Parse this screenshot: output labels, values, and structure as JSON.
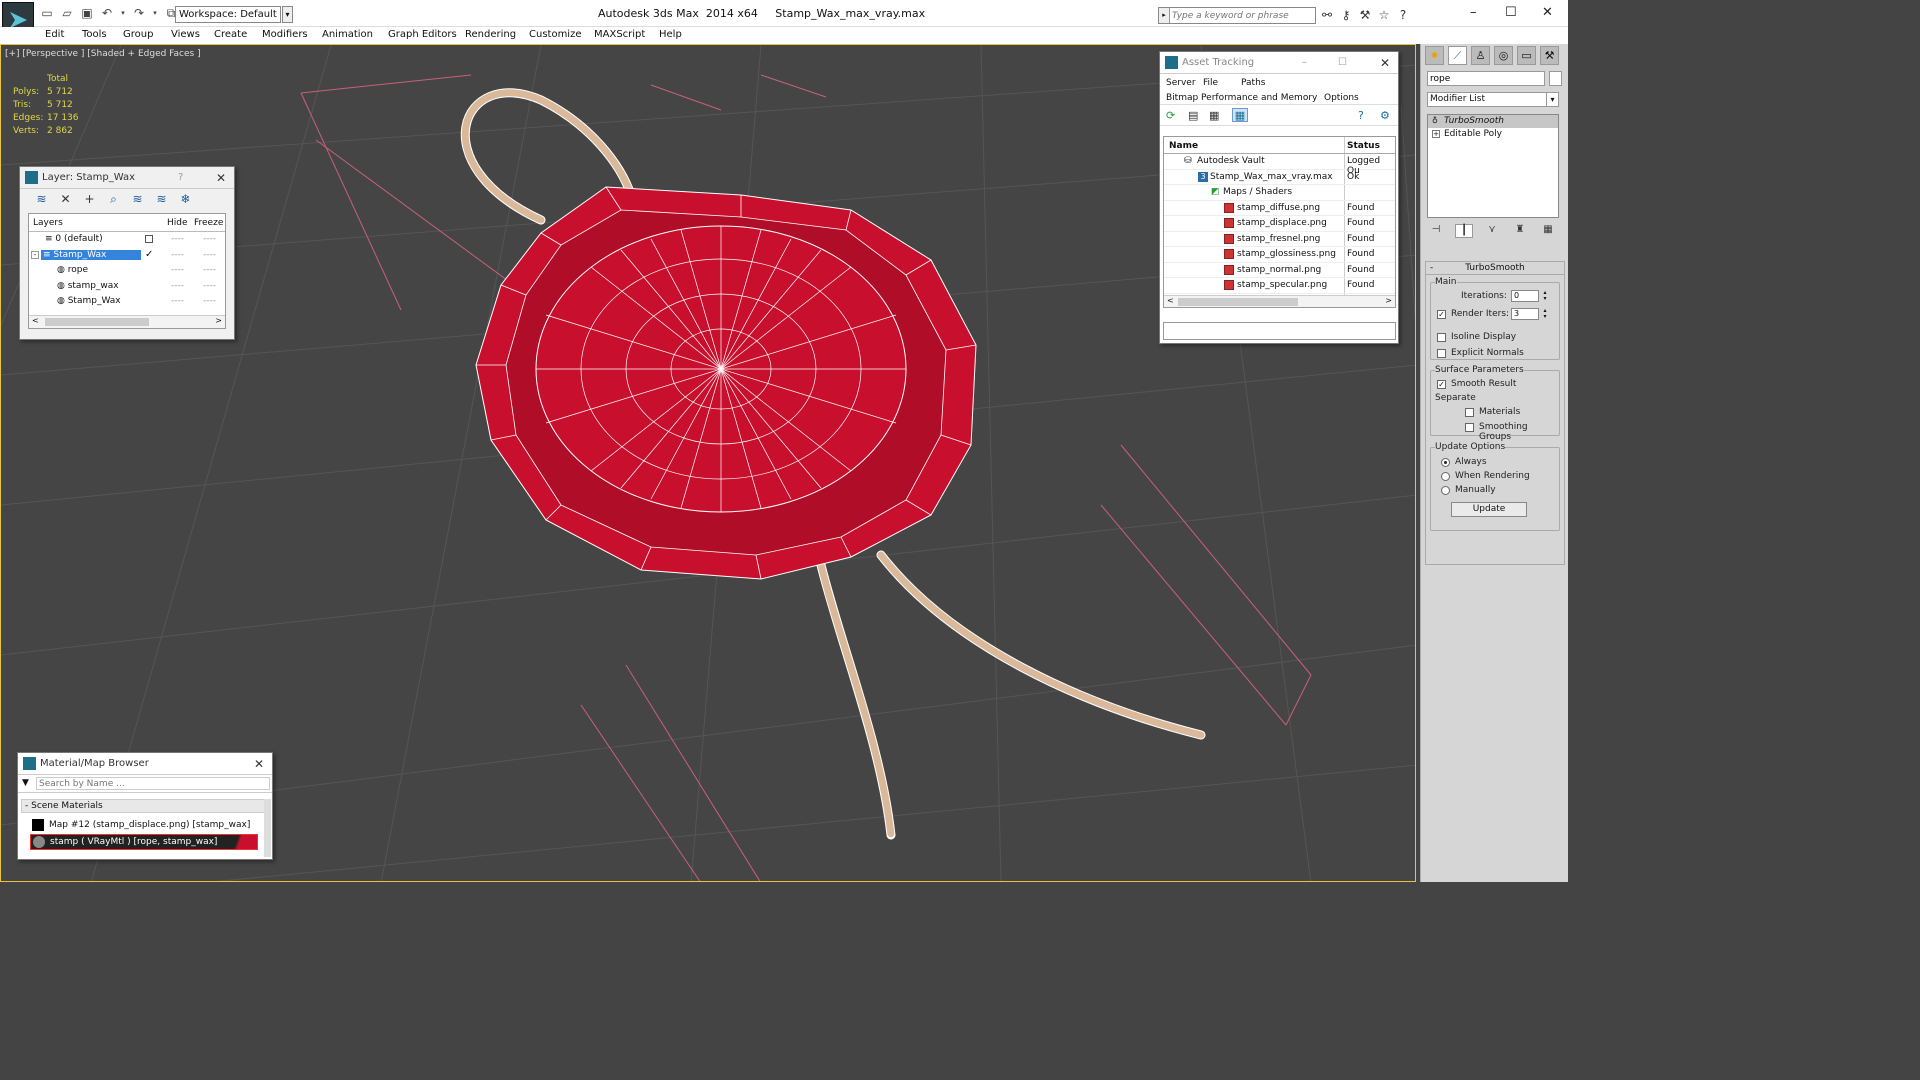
{
  "titlebar": {
    "workspace": "Workspace: Default",
    "title": "Autodesk 3ds Max  2014 x64     Stamp_Wax_max_vray.max",
    "search_placeholder": "Type a keyword or phrase"
  },
  "menu": [
    "Edit",
    "Tools",
    "Group",
    "Views",
    "Create",
    "Modifiers",
    "Animation",
    "Graph Editors",
    "Rendering",
    "Customize",
    "MAXScript",
    "Help"
  ],
  "viewport": {
    "label": "[+] [Perspective ] [Shaded + Edged Faces ]",
    "stats_header": "Total",
    "stats": [
      {
        "k": "Polys:",
        "v": "5 712"
      },
      {
        "k": "Tris:",
        "v": "5 712"
      },
      {
        "k": "Edges:",
        "v": "17 136"
      },
      {
        "k": "Verts:",
        "v": "2 862"
      }
    ],
    "colors": {
      "wax": "#c8102e",
      "rope": "#d9b99a",
      "grid": "#5a5a5a",
      "background": "#454545"
    }
  },
  "layer_panel": {
    "title": "Layer: Stamp_Wax",
    "help": "?",
    "columns": {
      "layers": "Layers",
      "hide": "Hide",
      "freeze": "Freeze"
    },
    "rows": [
      {
        "name": "0 (default)",
        "indent": 0,
        "selected": false
      },
      {
        "name": "Stamp_Wax",
        "indent": 0,
        "selected": true
      },
      {
        "name": "rope",
        "indent": 1,
        "selected": false
      },
      {
        "name": "stamp_wax",
        "indent": 1,
        "selected": false
      },
      {
        "name": "Stamp_Wax",
        "indent": 1,
        "selected": false
      }
    ],
    "dash": "----"
  },
  "asset_panel": {
    "title": "Asset Tracking",
    "menu": [
      "Server",
      "File",
      "Paths",
      "Bitmap Performance and Memory",
      "Options"
    ],
    "columns": {
      "name": "Name",
      "status": "Status"
    },
    "rows": [
      {
        "name": "Autodesk Vault",
        "status": "Logged Ou",
        "level": 1
      },
      {
        "name": "Stamp_Wax_max_vray.max",
        "status": "Ok",
        "level": 2
      },
      {
        "name": "Maps / Shaders",
        "status": "",
        "level": 3
      },
      {
        "name": "stamp_diffuse.png",
        "status": "Found",
        "level": 4
      },
      {
        "name": "stamp_displace.png",
        "status": "Found",
        "level": 4
      },
      {
        "name": "stamp_fresnel.png",
        "status": "Found",
        "level": 4
      },
      {
        "name": "stamp_glossiness.png",
        "status": "Found",
        "level": 4
      },
      {
        "name": "stamp_normal.png",
        "status": "Found",
        "level": 4
      },
      {
        "name": "stamp_specular.png",
        "status": "Found",
        "level": 4
      }
    ]
  },
  "material_browser": {
    "title": "Material/Map Browser",
    "search_placeholder": "Search by Name ...",
    "group": "- Scene Materials",
    "items": [
      {
        "label": "Map #12 (stamp_displace.png)  [stamp_wax]"
      },
      {
        "label": "stamp  ( VRayMtl )  [rope, stamp_wax]"
      }
    ]
  },
  "command_panel": {
    "object_name": "rope",
    "modifier_list": "Modifier List",
    "stack": [
      {
        "label": "TurboSmooth",
        "selected": true
      },
      {
        "label": "Editable Poly",
        "selected": false
      }
    ],
    "rollout_title": "TurboSmooth",
    "main_group": "Main",
    "iterations_label": "Iterations:",
    "iterations_value": "0",
    "render_iters_label": "Render Iters:",
    "render_iters_value": "3",
    "isoline": "Isoline Display",
    "explicit_normals": "Explicit Normals",
    "surface_group": "Surface Parameters",
    "smooth_result": "Smooth Result",
    "separate": "Separate",
    "materials": "Materials",
    "smoothing_groups": "Smoothing Groups",
    "update_group": "Update Options",
    "always": "Always",
    "when_rendering": "When Rendering",
    "manually": "Manually",
    "update_button": "Update"
  }
}
